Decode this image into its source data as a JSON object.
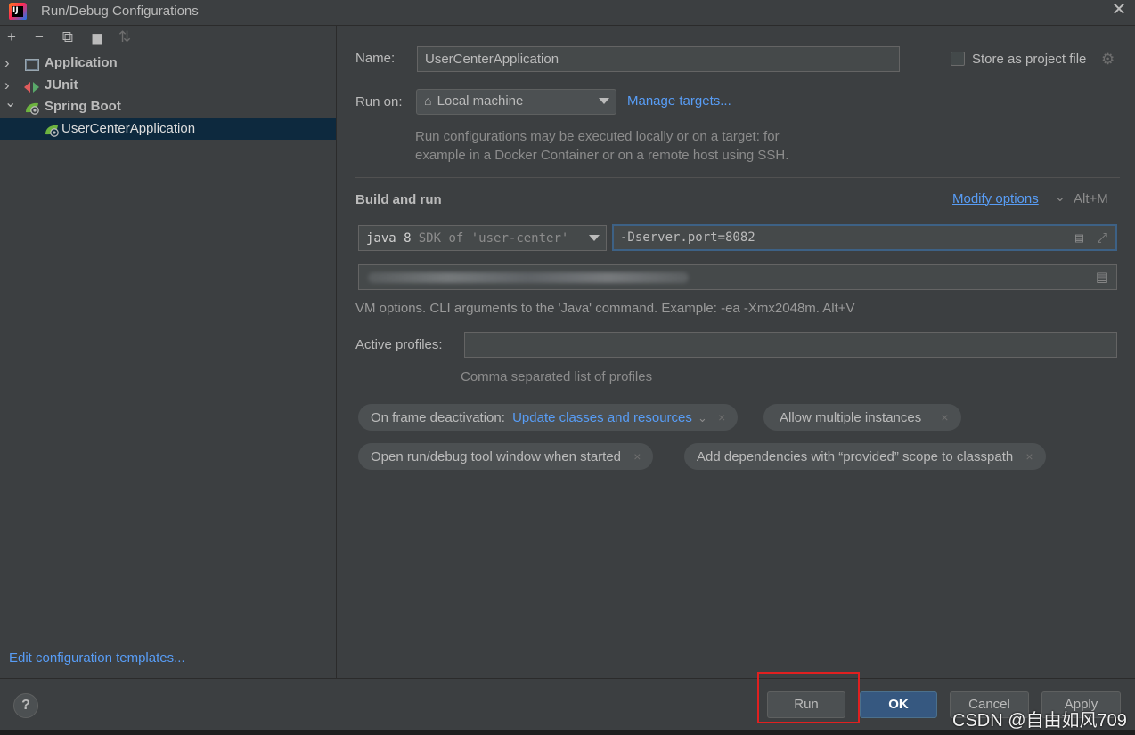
{
  "window": {
    "title": "Run/Debug Configurations",
    "close_glyph": "✕",
    "logo_text": "IJ"
  },
  "toolbar": {
    "add_glyph": "+",
    "remove_glyph": "−",
    "copy_glyph": "⧉",
    "folder_glyph": "▆",
    "sort_glyph": "⇅"
  },
  "tree": {
    "items": [
      {
        "label": "Application",
        "icon": "application-icon",
        "expanded": false
      },
      {
        "label": "JUnit",
        "icon": "junit-icon",
        "expanded": false
      },
      {
        "label": "Spring Boot",
        "icon": "spring-boot-icon",
        "expanded": true
      },
      {
        "label": "UserCenterApplication",
        "icon": "spring-boot-icon",
        "selected": true
      }
    ],
    "chevron_right": "›",
    "chevron_down": "⌄"
  },
  "left_footer": {
    "edit_templates": "Edit configuration templates..."
  },
  "form": {
    "name_label": "Name:",
    "name_value": "UserCenterApplication",
    "store_label": "Store as project file",
    "run_on_label": "Run on:",
    "run_on_value": "Local machine",
    "manage_targets": "Manage targets...",
    "run_on_hint_1": "Run configurations may be executed locally or on a target: for",
    "run_on_hint_2": "example in a Docker Container or on a remote host using SSH.",
    "build_and_run": "Build and run",
    "modify_options": "Modify options",
    "modify_shortcut": "Alt+M",
    "sdk_java": "java 8",
    "sdk_detail": "SDK of 'user-center'",
    "vm_options_value": "-Dserver.port=8082",
    "vm_hint": "VM options. CLI arguments to the 'Java' command. Example: -ea -Xmx2048m. Alt+V",
    "active_profiles_label": "Active profiles:",
    "active_profiles_value": "",
    "active_profiles_hint": "Comma separated list of profiles"
  },
  "chips": {
    "frame_label": "On frame deactivation:",
    "frame_value": "Update classes and resources",
    "allow_multiple": "Allow multiple instances",
    "open_window": "Open run/debug tool window when started",
    "add_dependencies": "Add dependencies with “provided” scope to classpath",
    "remove_glyph": "×",
    "dropdown_glyph": "⌄"
  },
  "buttons": {
    "help": "?",
    "run": "Run",
    "ok": "OK",
    "cancel": "Cancel",
    "apply": "Apply"
  },
  "watermark": "CSDN @自由如风709",
  "colors": {
    "background": "#3c3f41",
    "selected_row": "#0d293e",
    "link": "#589df6",
    "ok_button": "#365880",
    "highlight": "#e02020"
  }
}
